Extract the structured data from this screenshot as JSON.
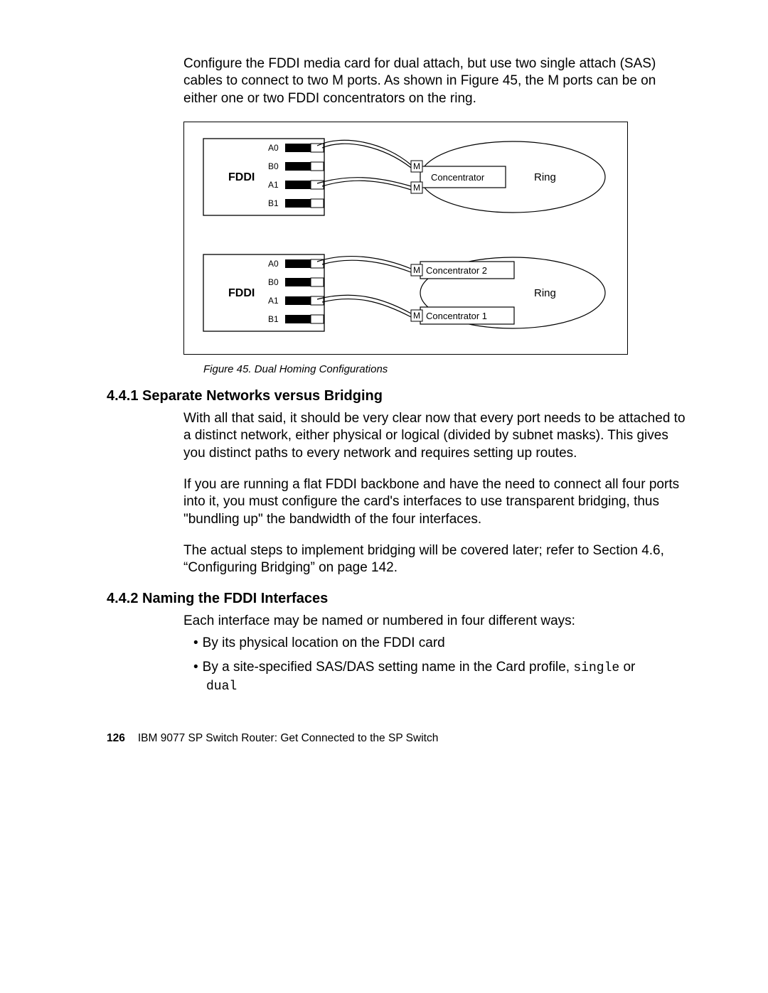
{
  "intro_para": "Configure the FDDI media card for dual attach, but use two single attach (SAS) cables to connect to two M ports. As shown in Figure 45, the M ports can be on either one or two FDDI concentrators on the ring.",
  "figure": {
    "caption": "Figure 45.  Dual Homing Configurations",
    "top": {
      "card_label": "FDDI",
      "ports": [
        "A0",
        "B0",
        "A1",
        "B1"
      ],
      "m1": "M",
      "m2": "M",
      "concentrator": "Concentrator",
      "ring": "Ring"
    },
    "bottom": {
      "card_label": "FDDI",
      "ports": [
        "A0",
        "B0",
        "A1",
        "B1"
      ],
      "m1": "M",
      "m2": "M",
      "concentrator1": "Concentrator 1",
      "concentrator2": "Concentrator 2",
      "ring": "Ring"
    }
  },
  "s441": {
    "heading": "4.4.1  Separate Networks versus Bridging",
    "p1": "With all that said, it should be very clear now that every port needs to be attached to a distinct network, either physical or logical (divided by subnet masks). This gives you distinct paths to every network and requires setting up routes.",
    "p2": "If you are running a flat FDDI backbone and have the need to connect all four ports into it, you must configure the card's interfaces to use transparent bridging, thus \"bundling up\" the bandwidth of the four interfaces.",
    "p3": "The actual steps to implement bridging will be covered later; refer to Section 4.6, “Configuring Bridging” on page 142."
  },
  "s442": {
    "heading": "4.4.2  Naming the FDDI Interfaces",
    "intro": "Each interface may be named or numbered in four different ways:",
    "b1": "By its physical location on the FDDI card",
    "b2_pre": "By a site-specified SAS/DAS setting name in the Card profile, ",
    "b2_code1": "single",
    "b2_mid": " or ",
    "b2_code2": "dual"
  },
  "footer": {
    "page": "126",
    "title": "IBM 9077 SP Switch Router: Get Connected to the SP Switch"
  }
}
